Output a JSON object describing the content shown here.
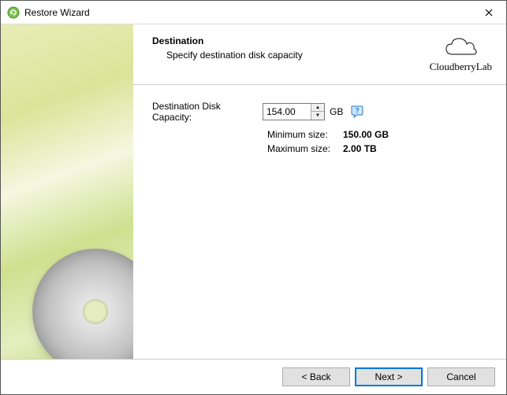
{
  "window": {
    "title": "Restore Wizard"
  },
  "brand": {
    "name": "CloudberryLab"
  },
  "header": {
    "title": "Destination",
    "subtitle": "Specify destination disk capacity"
  },
  "form": {
    "capacity_label": "Destination Disk Capacity:",
    "capacity_value": "154.00",
    "unit": "GB",
    "min_label": "Minimum size:",
    "min_value": "150.00 GB",
    "max_label": "Maximum size:",
    "max_value": "2.00 TB"
  },
  "footer": {
    "back": "< Back",
    "next": "Next >",
    "cancel": "Cancel"
  }
}
